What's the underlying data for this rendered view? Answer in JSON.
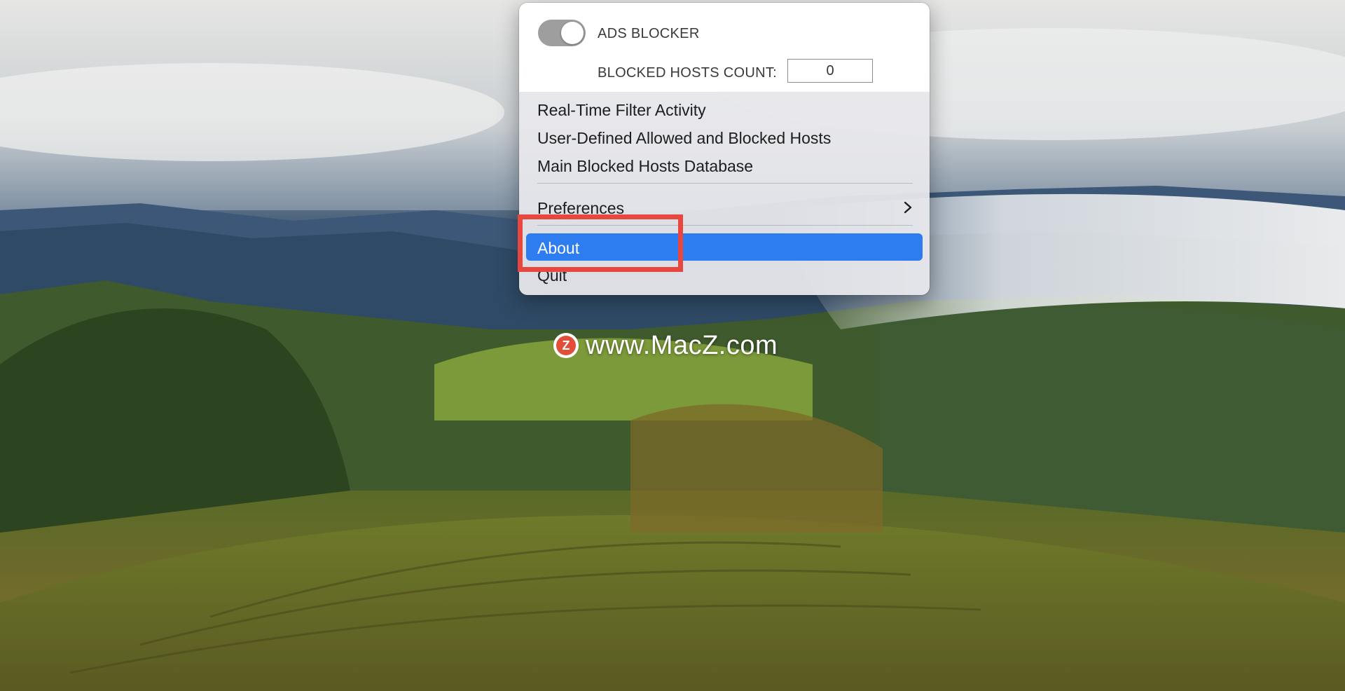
{
  "ads_blocker": {
    "label": "ADS BLOCKER",
    "enabled": false
  },
  "blocked_hosts": {
    "label": "BLOCKED HOSTS COUNT:",
    "value": "0"
  },
  "menu": {
    "items": [
      {
        "label": "Real-Time Filter Activity"
      },
      {
        "label": "User-Defined Allowed and Blocked Hosts"
      },
      {
        "label": "Main Blocked Hosts Database"
      },
      {
        "label": "Preferences",
        "icon": "chevron-right-icon"
      },
      {
        "label": "About",
        "selected": true
      },
      {
        "label": "Quit"
      }
    ]
  },
  "watermark": {
    "text": "www.MacZ.com",
    "badge_letter": "Z"
  },
  "colors": {
    "highlight": "#2d7cf0",
    "annotation": "#e8473f",
    "toggle_off": "#9e9e9e"
  }
}
